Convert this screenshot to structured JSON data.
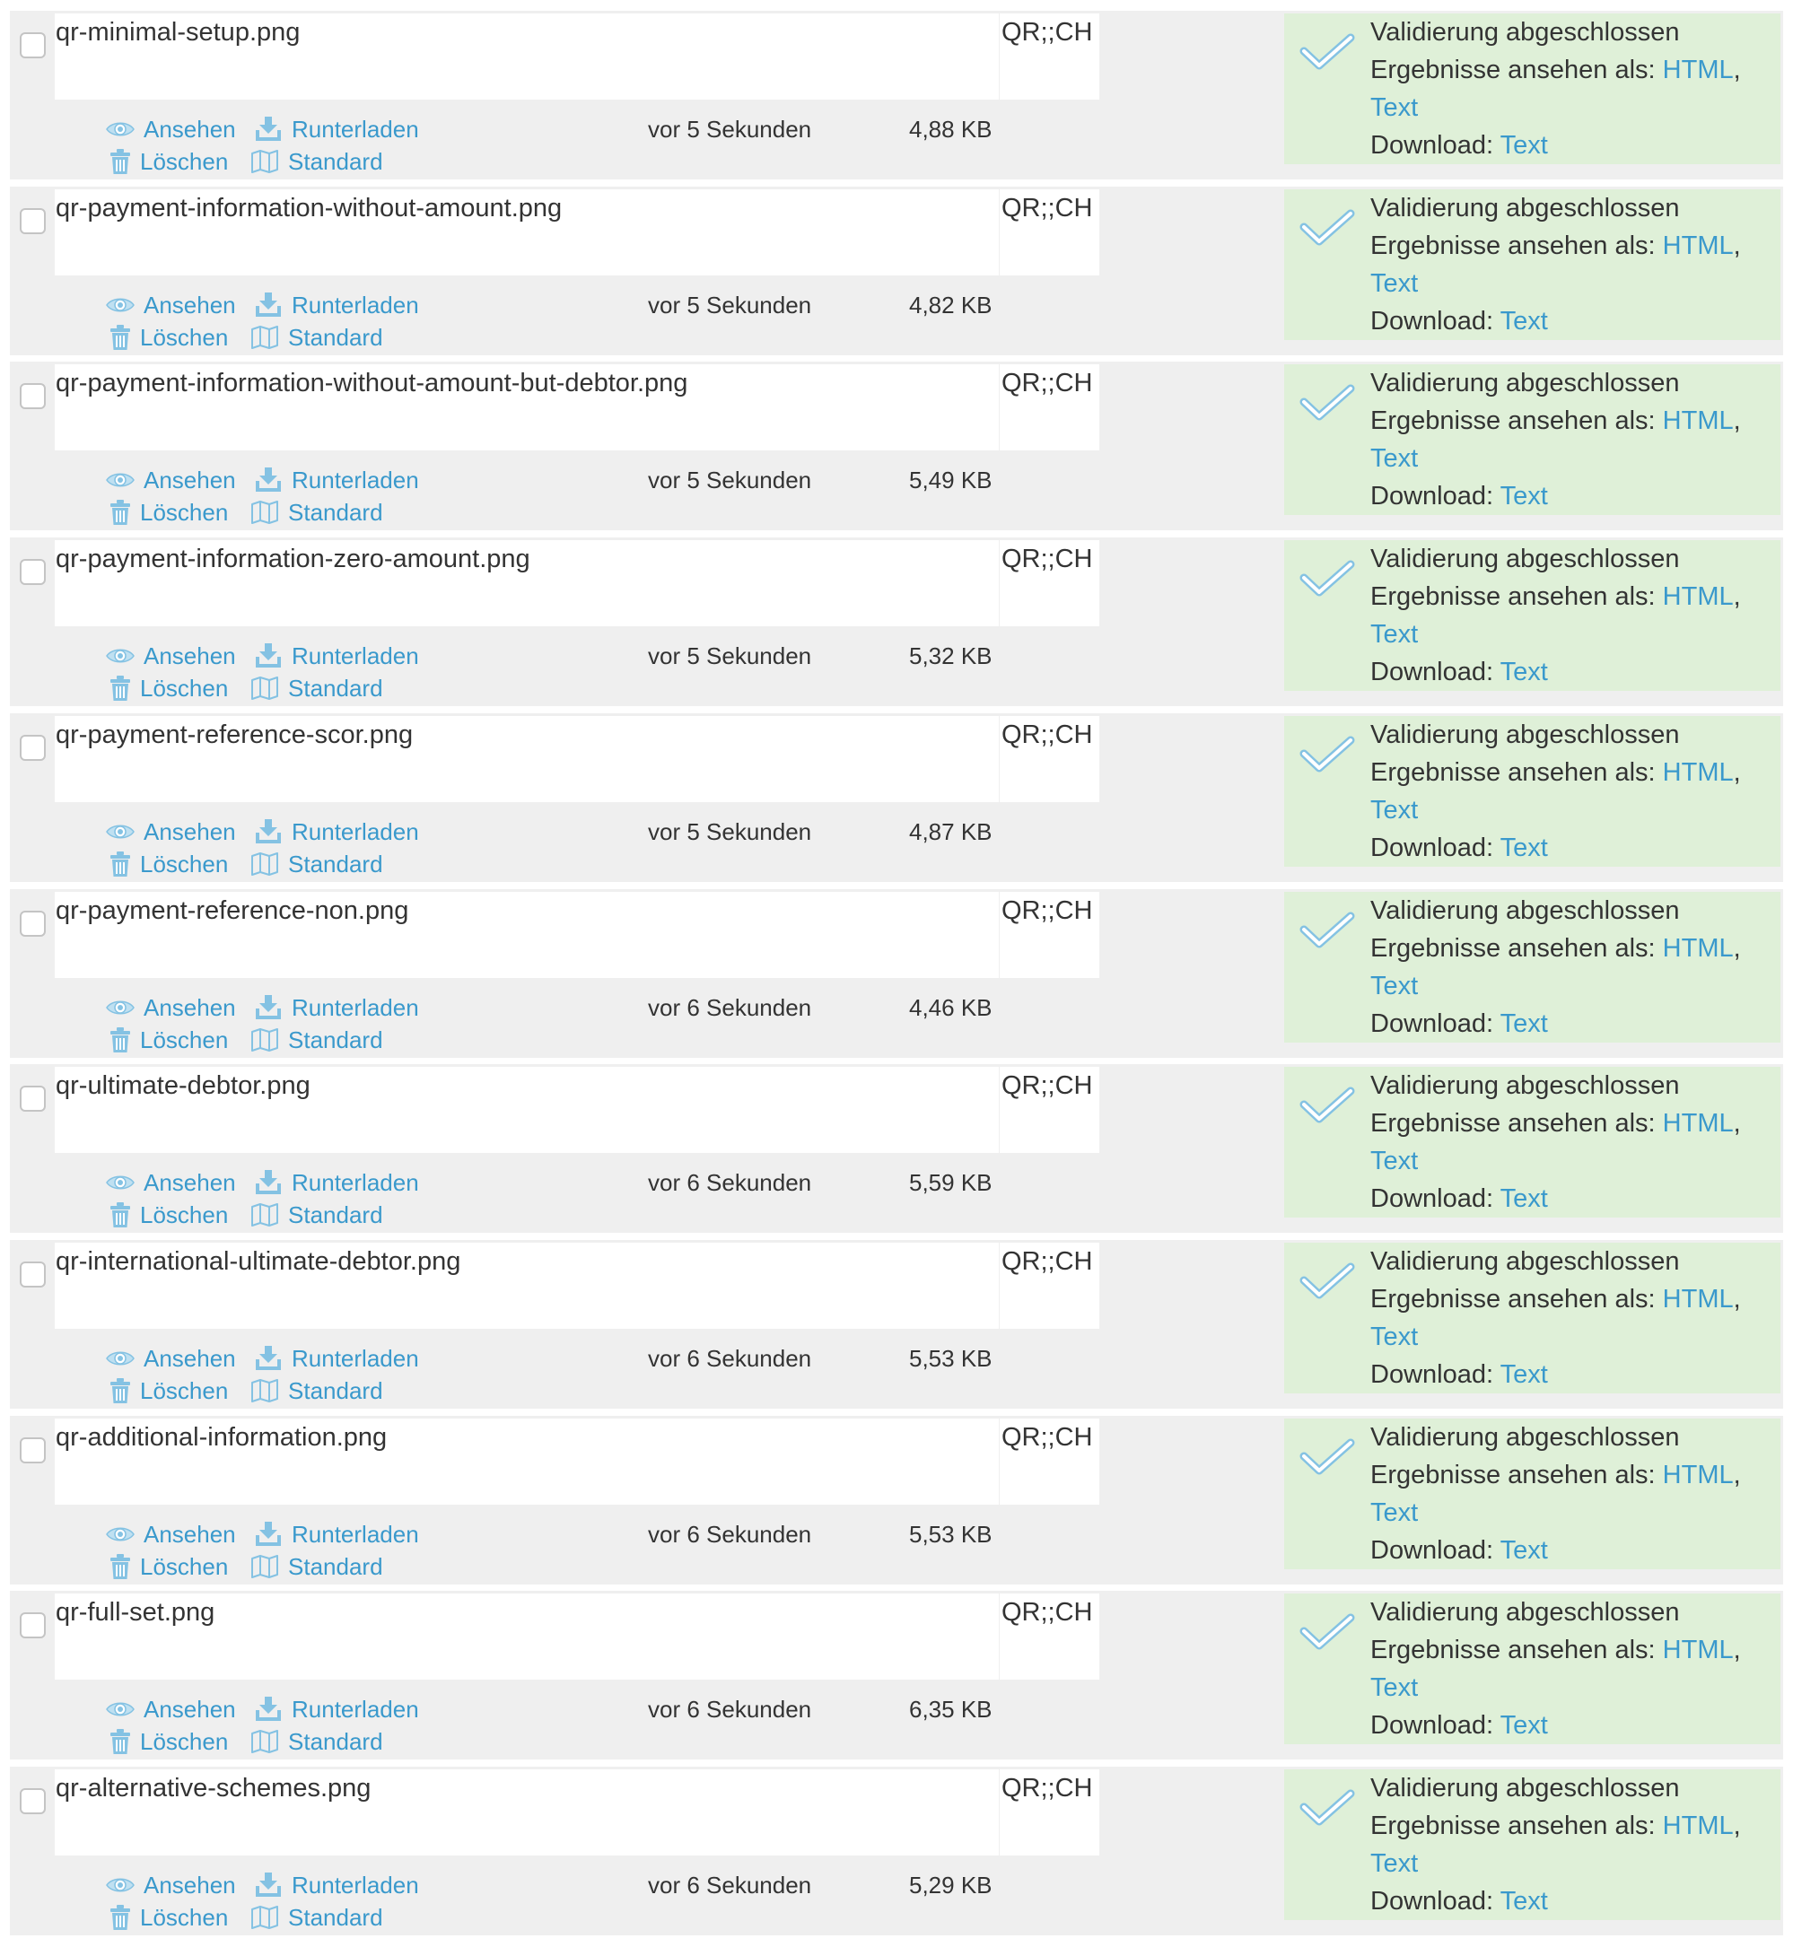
{
  "labels": {
    "view": "Ansehen",
    "download": "Runterladen",
    "delete": "Löschen",
    "standard": "Standard",
    "status": "Validierung abgeschlossen",
    "results_prefix": "Ergebnisse ansehen als:",
    "html": "HTML",
    "comma": ",",
    "text": "Text",
    "download_prefix": "Download:"
  },
  "colors": {
    "link": "#3a99cc",
    "row_bg": "#efefef",
    "success_bg": "#dff0d8"
  },
  "icons": [
    "eye-icon",
    "download-tray-icon",
    "trash-icon",
    "map-icon",
    "checkmark-icon"
  ],
  "files": [
    {
      "name": "qr-minimal-setup.png",
      "type": "QR;;CH",
      "time": "vor 5 Sekunden",
      "size": "4,88 KB"
    },
    {
      "name": "qr-payment-information-without-amount.png",
      "type": "QR;;CH",
      "time": "vor 5 Sekunden",
      "size": "4,82 KB"
    },
    {
      "name": "qr-payment-information-without-amount-but-debtor.png",
      "type": "QR;;CH",
      "time": "vor 5 Sekunden",
      "size": "5,49 KB"
    },
    {
      "name": "qr-payment-information-zero-amount.png",
      "type": "QR;;CH",
      "time": "vor 5 Sekunden",
      "size": "5,32 KB"
    },
    {
      "name": "qr-payment-reference-scor.png",
      "type": "QR;;CH",
      "time": "vor 5 Sekunden",
      "size": "4,87 KB"
    },
    {
      "name": "qr-payment-reference-non.png",
      "type": "QR;;CH",
      "time": "vor 6 Sekunden",
      "size": "4,46 KB"
    },
    {
      "name": "qr-ultimate-debtor.png",
      "type": "QR;;CH",
      "time": "vor 6 Sekunden",
      "size": "5,59 KB"
    },
    {
      "name": "qr-international-ultimate-debtor.png",
      "type": "QR;;CH",
      "time": "vor 6 Sekunden",
      "size": "5,53 KB"
    },
    {
      "name": "qr-additional-information.png",
      "type": "QR;;CH",
      "time": "vor 6 Sekunden",
      "size": "5,53 KB"
    },
    {
      "name": "qr-full-set.png",
      "type": "QR;;CH",
      "time": "vor 6 Sekunden",
      "size": "6,35 KB"
    },
    {
      "name": "qr-alternative-schemes.png",
      "type": "QR;;CH",
      "time": "vor 6 Sekunden",
      "size": "5,29 KB"
    }
  ]
}
